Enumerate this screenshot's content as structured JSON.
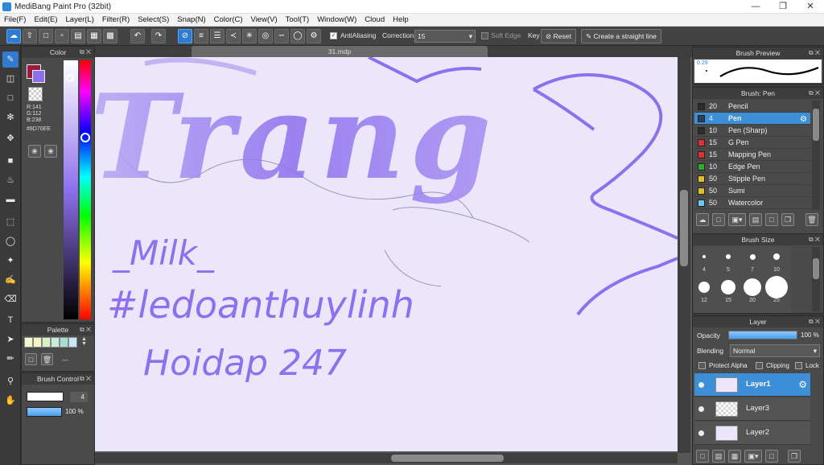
{
  "app": {
    "title": "MediBang Paint Pro (32bit)"
  },
  "menu": [
    "File(F)",
    "Edit(E)",
    "Layer(L)",
    "Filter(R)",
    "Select(S)",
    "Snap(N)",
    "Color(C)",
    "View(V)",
    "Tool(T)",
    "Window(W)",
    "Cloud",
    "Help"
  ],
  "toolbar": {
    "antialiasing_label": "AntiAliasing",
    "correction_label": "Correction",
    "correction_value": "15",
    "soft_edge_label": "Soft Edge",
    "key_label": "Key",
    "reset_label": "Reset",
    "straight_line_label": "Create a straight line"
  },
  "document": {
    "tab_name": "31.mdp"
  },
  "color_panel": {
    "title": "Color",
    "r": "R:141",
    "g": "G:112",
    "b": "B:238",
    "hex": "#8D70EE",
    "main_color": "#8D70EE",
    "sub_color": "#9c1a3a"
  },
  "palette_panel": {
    "title": "Palette",
    "empty_label": "---",
    "swatches": [
      "#f3f8c8",
      "#f0f7c3",
      "#d7f0c8",
      "#c9ecd8",
      "#a6dfd0",
      "#c8e6f5"
    ]
  },
  "brush_control": {
    "title": "Brush Control",
    "size": "4",
    "opacity": "100 %",
    "opacity_value": 100
  },
  "brush_preview": {
    "title": "Brush Preview",
    "size_label": "0.29"
  },
  "brush_list": {
    "title": "Brush: Pen",
    "items": [
      {
        "size": "20",
        "name": "Pencil",
        "color": "#2c2c2c"
      },
      {
        "size": "4",
        "name": "Pen",
        "color": "#2c3f55"
      },
      {
        "size": "10",
        "name": "Pen (Sharp)",
        "color": "#2c2c2c"
      },
      {
        "size": "15",
        "name": "G Pen",
        "color": "#e03030"
      },
      {
        "size": "15",
        "name": "Mapping Pen",
        "color": "#e03030"
      },
      {
        "size": "10",
        "name": "Edge Pen",
        "color": "#28b028"
      },
      {
        "size": "50",
        "name": "Stipple Pen",
        "color": "#e0c020"
      },
      {
        "size": "50",
        "name": "Sumi",
        "color": "#e0c020"
      },
      {
        "size": "50",
        "name": "Watercolor",
        "color": "#68c8f0"
      }
    ]
  },
  "brush_size": {
    "title": "Brush Size",
    "sizes": [
      "4",
      "5",
      "7",
      "10",
      "12",
      "15",
      "20",
      "25"
    ]
  },
  "layer_panel": {
    "title": "Layer",
    "opacity_label": "Opacity",
    "opacity_value": "100 %",
    "opacity_fraction": 1.0,
    "blending_label": "Blending",
    "blending_value": "Normal",
    "protect_alpha_label": "Protect Alpha",
    "clipping_label": "Clipping",
    "lock_label": "Lock",
    "layers": [
      "Layer1",
      "Layer3",
      "Layer2"
    ]
  },
  "artwork": {
    "word_big": "Trang",
    "line1": "_Milk_",
    "line2": "#ledoanthuylinh",
    "line3": "Hoidap 247"
  }
}
